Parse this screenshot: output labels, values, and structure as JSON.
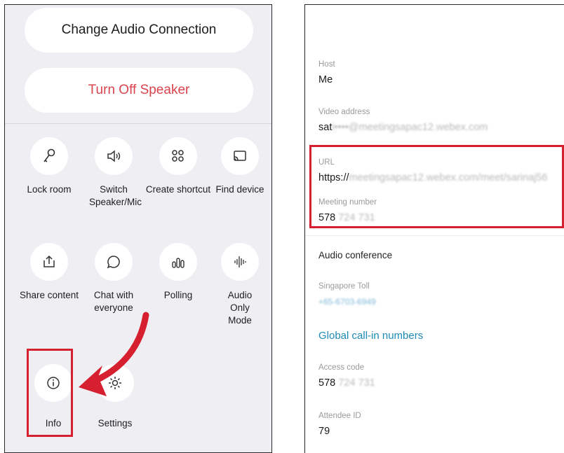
{
  "left": {
    "change_audio": "Change Audio Connection",
    "turn_off_speaker": "Turn Off Speaker",
    "actions": [
      {
        "label": "Lock room",
        "icon": "key-icon"
      },
      {
        "label": "Switch Speaker/Mic",
        "icon": "speaker-icon"
      },
      {
        "label": "Create shortcut",
        "icon": "grid-icon"
      },
      {
        "label": "Find device",
        "icon": "cast-icon"
      },
      {
        "label": "Share content",
        "icon": "share-icon"
      },
      {
        "label": "Chat with everyone",
        "icon": "chat-bubble-icon"
      },
      {
        "label": "Polling",
        "icon": "poll-icon"
      },
      {
        "label": "Audio Only Mode",
        "icon": "waveform-icon"
      },
      {
        "label": "Info",
        "icon": "info-icon"
      },
      {
        "label": "Settings",
        "icon": "settings-icon"
      }
    ]
  },
  "right": {
    "host": {
      "label": "Host",
      "value": "Me"
    },
    "video_address": {
      "label": "Video address",
      "value_visible": "sat",
      "value_blurred": "i••••@meetingsapac12.webex.com"
    },
    "url": {
      "label": "URL",
      "value_visible": "https://",
      "value_blurred": "meetingsapac12.webex.com/meet/sarinaj56"
    },
    "meeting_number": {
      "label": "Meeting number",
      "value_visible": "578",
      "value_blurred": "724 731"
    },
    "audio_conference": "Audio conference",
    "singapore_toll": {
      "label": "Singapore Toll",
      "value_blurred": "+65-6703-6949"
    },
    "global_callin": "Global call-in numbers",
    "access_code": {
      "label": "Access code",
      "value_visible": "578",
      "value_blurred": "724 731"
    },
    "attendee_id": {
      "label": "Attendee ID",
      "value": "79"
    }
  },
  "colors": {
    "highlight": "#d62030",
    "speaker_red": "#d9434d",
    "link_blue": "#1d8ab5",
    "panel_bg": "#efeef2"
  }
}
